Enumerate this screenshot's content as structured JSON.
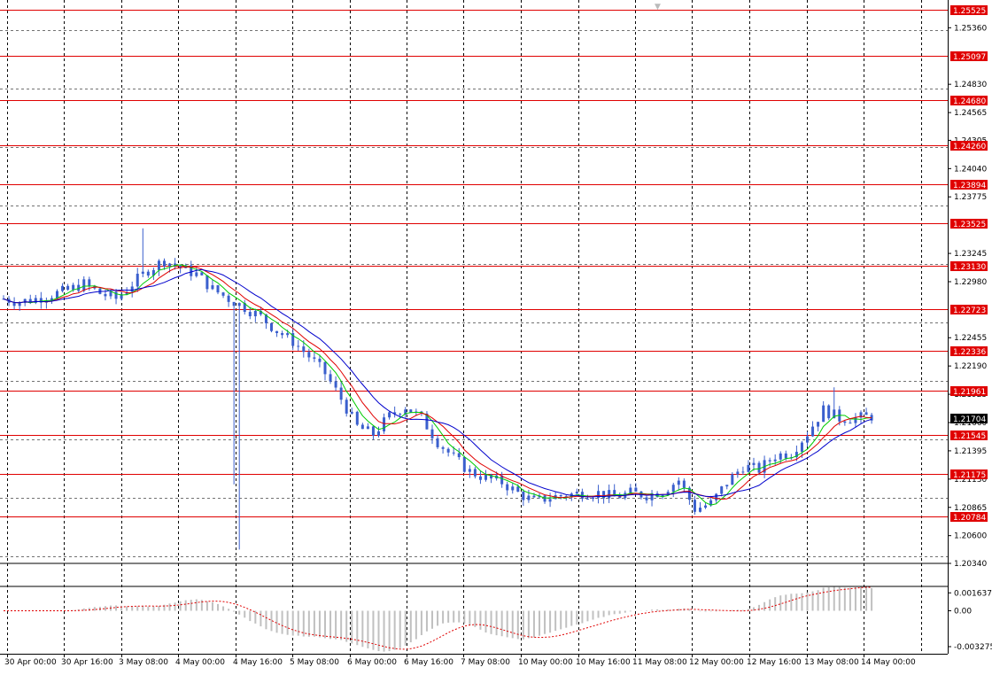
{
  "chart_data": {
    "type": "candlestick",
    "symbol_note": "",
    "timeframe_note": "",
    "colors": {
      "background": "#ffffff",
      "price_bars": "#3a5fcd",
      "ma_fast": "#00cc00",
      "ma_mid": "#e00000",
      "ma_slow": "#0000cc",
      "levels": "#e00000",
      "grid": "#000000",
      "osc_hist": "#c0c0c0",
      "osc_signal": "#e00000",
      "bid_label": "#000000"
    },
    "price_axis": {
      "ylim": [
        1.2034,
        1.2562
      ],
      "ticks": [
        "1.25360",
        "1.24830",
        "1.24565",
        "1.24305",
        "1.24040",
        "1.23775",
        "1.23245",
        "1.22980",
        "1.22455",
        "1.22190",
        "1.21925",
        "1.21660",
        "1.21395",
        "1.21130",
        "1.20865",
        "1.20600",
        "1.20340"
      ]
    },
    "levels": [
      "1.25525",
      "1.25097",
      "1.24680",
      "1.24260",
      "1.23894",
      "1.23525",
      "1.23130",
      "1.22723",
      "1.22336",
      "1.21961",
      "1.21545",
      "1.21175",
      "1.20784"
    ],
    "current_price": "1.21704",
    "time_axis": {
      "labels": [
        "30 Apr 00:00",
        "30 Apr 16:00",
        "3 May 08:00",
        "4 May 00:00",
        "4 May 16:00",
        "5 May 08:00",
        "6 May 00:00",
        "6 May 16:00",
        "7 May 08:00",
        "10 May 00:00",
        "10 May 16:00",
        "11 May 08:00",
        "12 May 00:00",
        "12 May 16:00",
        "13 May 08:00",
        "14 May 00:00"
      ]
    },
    "path_anchors": [
      [
        0,
        1.2282
      ],
      [
        3,
        1.2279
      ],
      [
        6,
        1.2282
      ],
      [
        9,
        1.2286
      ],
      [
        12,
        1.229
      ],
      [
        15,
        1.2296
      ],
      [
        18,
        1.2287
      ],
      [
        21,
        1.2282
      ],
      [
        24,
        1.2296
      ],
      [
        27,
        1.2309
      ],
      [
        30,
        1.2318
      ],
      [
        33,
        1.2311
      ],
      [
        36,
        1.2305
      ],
      [
        39,
        1.2291
      ],
      [
        42,
        1.2282
      ],
      [
        45,
        1.2274
      ],
      [
        48,
        1.2265
      ],
      [
        51,
        1.2252
      ],
      [
        54,
        1.2242
      ],
      [
        57,
        1.2228
      ],
      [
        60,
        1.2212
      ],
      [
        63,
        1.2188
      ],
      [
        66,
        1.2162
      ],
      [
        69,
        1.2155
      ],
      [
        72,
        1.2172
      ],
      [
        75,
        1.2181
      ],
      [
        78,
        1.217
      ],
      [
        81,
        1.2148
      ],
      [
        84,
        1.2133
      ],
      [
        87,
        1.212
      ],
      [
        90,
        1.2114
      ],
      [
        93,
        1.211
      ],
      [
        96,
        1.21
      ],
      [
        99,
        1.2092
      ],
      [
        102,
        1.2096
      ],
      [
        105,
        1.2098
      ],
      [
        108,
        1.21
      ],
      [
        111,
        1.21
      ],
      [
        114,
        1.2096
      ],
      [
        117,
        1.21
      ],
      [
        120,
        1.2098
      ],
      [
        123,
        1.2102
      ],
      [
        126,
        1.2112
      ],
      [
        129,
        1.2085
      ],
      [
        132,
        1.209
      ],
      [
        135,
        1.211
      ],
      [
        138,
        1.2125
      ],
      [
        141,
        1.2122
      ],
      [
        144,
        1.2135
      ],
      [
        147,
        1.2138
      ],
      [
        150,
        1.2156
      ],
      [
        153,
        1.2178
      ],
      [
        156,
        1.217
      ],
      [
        159,
        1.217
      ],
      [
        162,
        1.2172
      ]
    ],
    "oscillator": {
      "ticks": [
        "0.001637",
        "0.00",
        "-0.003275"
      ],
      "range": [
        -0.0036,
        0.0019
      ]
    },
    "grid": true
  },
  "top_marker": "▼"
}
